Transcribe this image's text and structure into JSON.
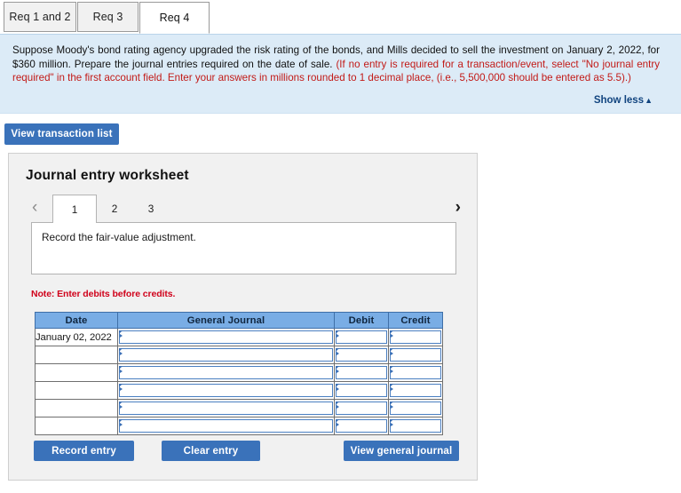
{
  "tabs": [
    {
      "label": "Req 1 and 2",
      "active": false
    },
    {
      "label": "Req 3",
      "active": false
    },
    {
      "label": "Req 4",
      "active": true
    }
  ],
  "instructions": {
    "black_part": "Suppose Moody's bond rating agency upgraded the risk rating of the bonds, and Mills decided to sell the investment on January 2, 2022, for $360 million. Prepare the journal entries required on the date of sale. ",
    "red_part": "(If no entry is required for a transaction/event, select \"No journal entry required\" in the first account field. Enter your answers in millions rounded to 1 decimal place, (i.e., 5,500,000 should be entered as 5.5).)",
    "show_less_label": "Show less",
    "show_less_caret": "▲"
  },
  "toolbar": {
    "view_transaction_list_label": "View transaction list"
  },
  "worksheet": {
    "title": "Journal entry worksheet",
    "pager": {
      "prev_icon": "‹",
      "next_icon": "›",
      "pages": [
        {
          "label": "1",
          "active": true
        },
        {
          "label": "2",
          "active": false
        },
        {
          "label": "3",
          "active": false
        }
      ]
    },
    "description": "Record the fair-value adjustment.",
    "note": "Note: Enter debits before credits.",
    "table": {
      "headers": [
        "Date",
        "General Journal",
        "Debit",
        "Credit"
      ],
      "rows": [
        {
          "date": "January 02, 2022",
          "journal": "",
          "debit": "",
          "credit": ""
        },
        {
          "date": "",
          "journal": "",
          "debit": "",
          "credit": ""
        },
        {
          "date": "",
          "journal": "",
          "debit": "",
          "credit": ""
        },
        {
          "date": "",
          "journal": "",
          "debit": "",
          "credit": ""
        },
        {
          "date": "",
          "journal": "",
          "debit": "",
          "credit": ""
        },
        {
          "date": "",
          "journal": "",
          "debit": "",
          "credit": ""
        }
      ]
    },
    "actions": {
      "record_entry_label": "Record entry",
      "clear_entry_label": "Clear entry",
      "view_general_journal_label": "View general journal"
    }
  },
  "colors": {
    "accent_blue": "#3a72ba",
    "panel_blue": "#dcebf7",
    "table_header_blue": "#79ade5",
    "note_red": "#d0021b",
    "link_navy": "#11447f"
  }
}
